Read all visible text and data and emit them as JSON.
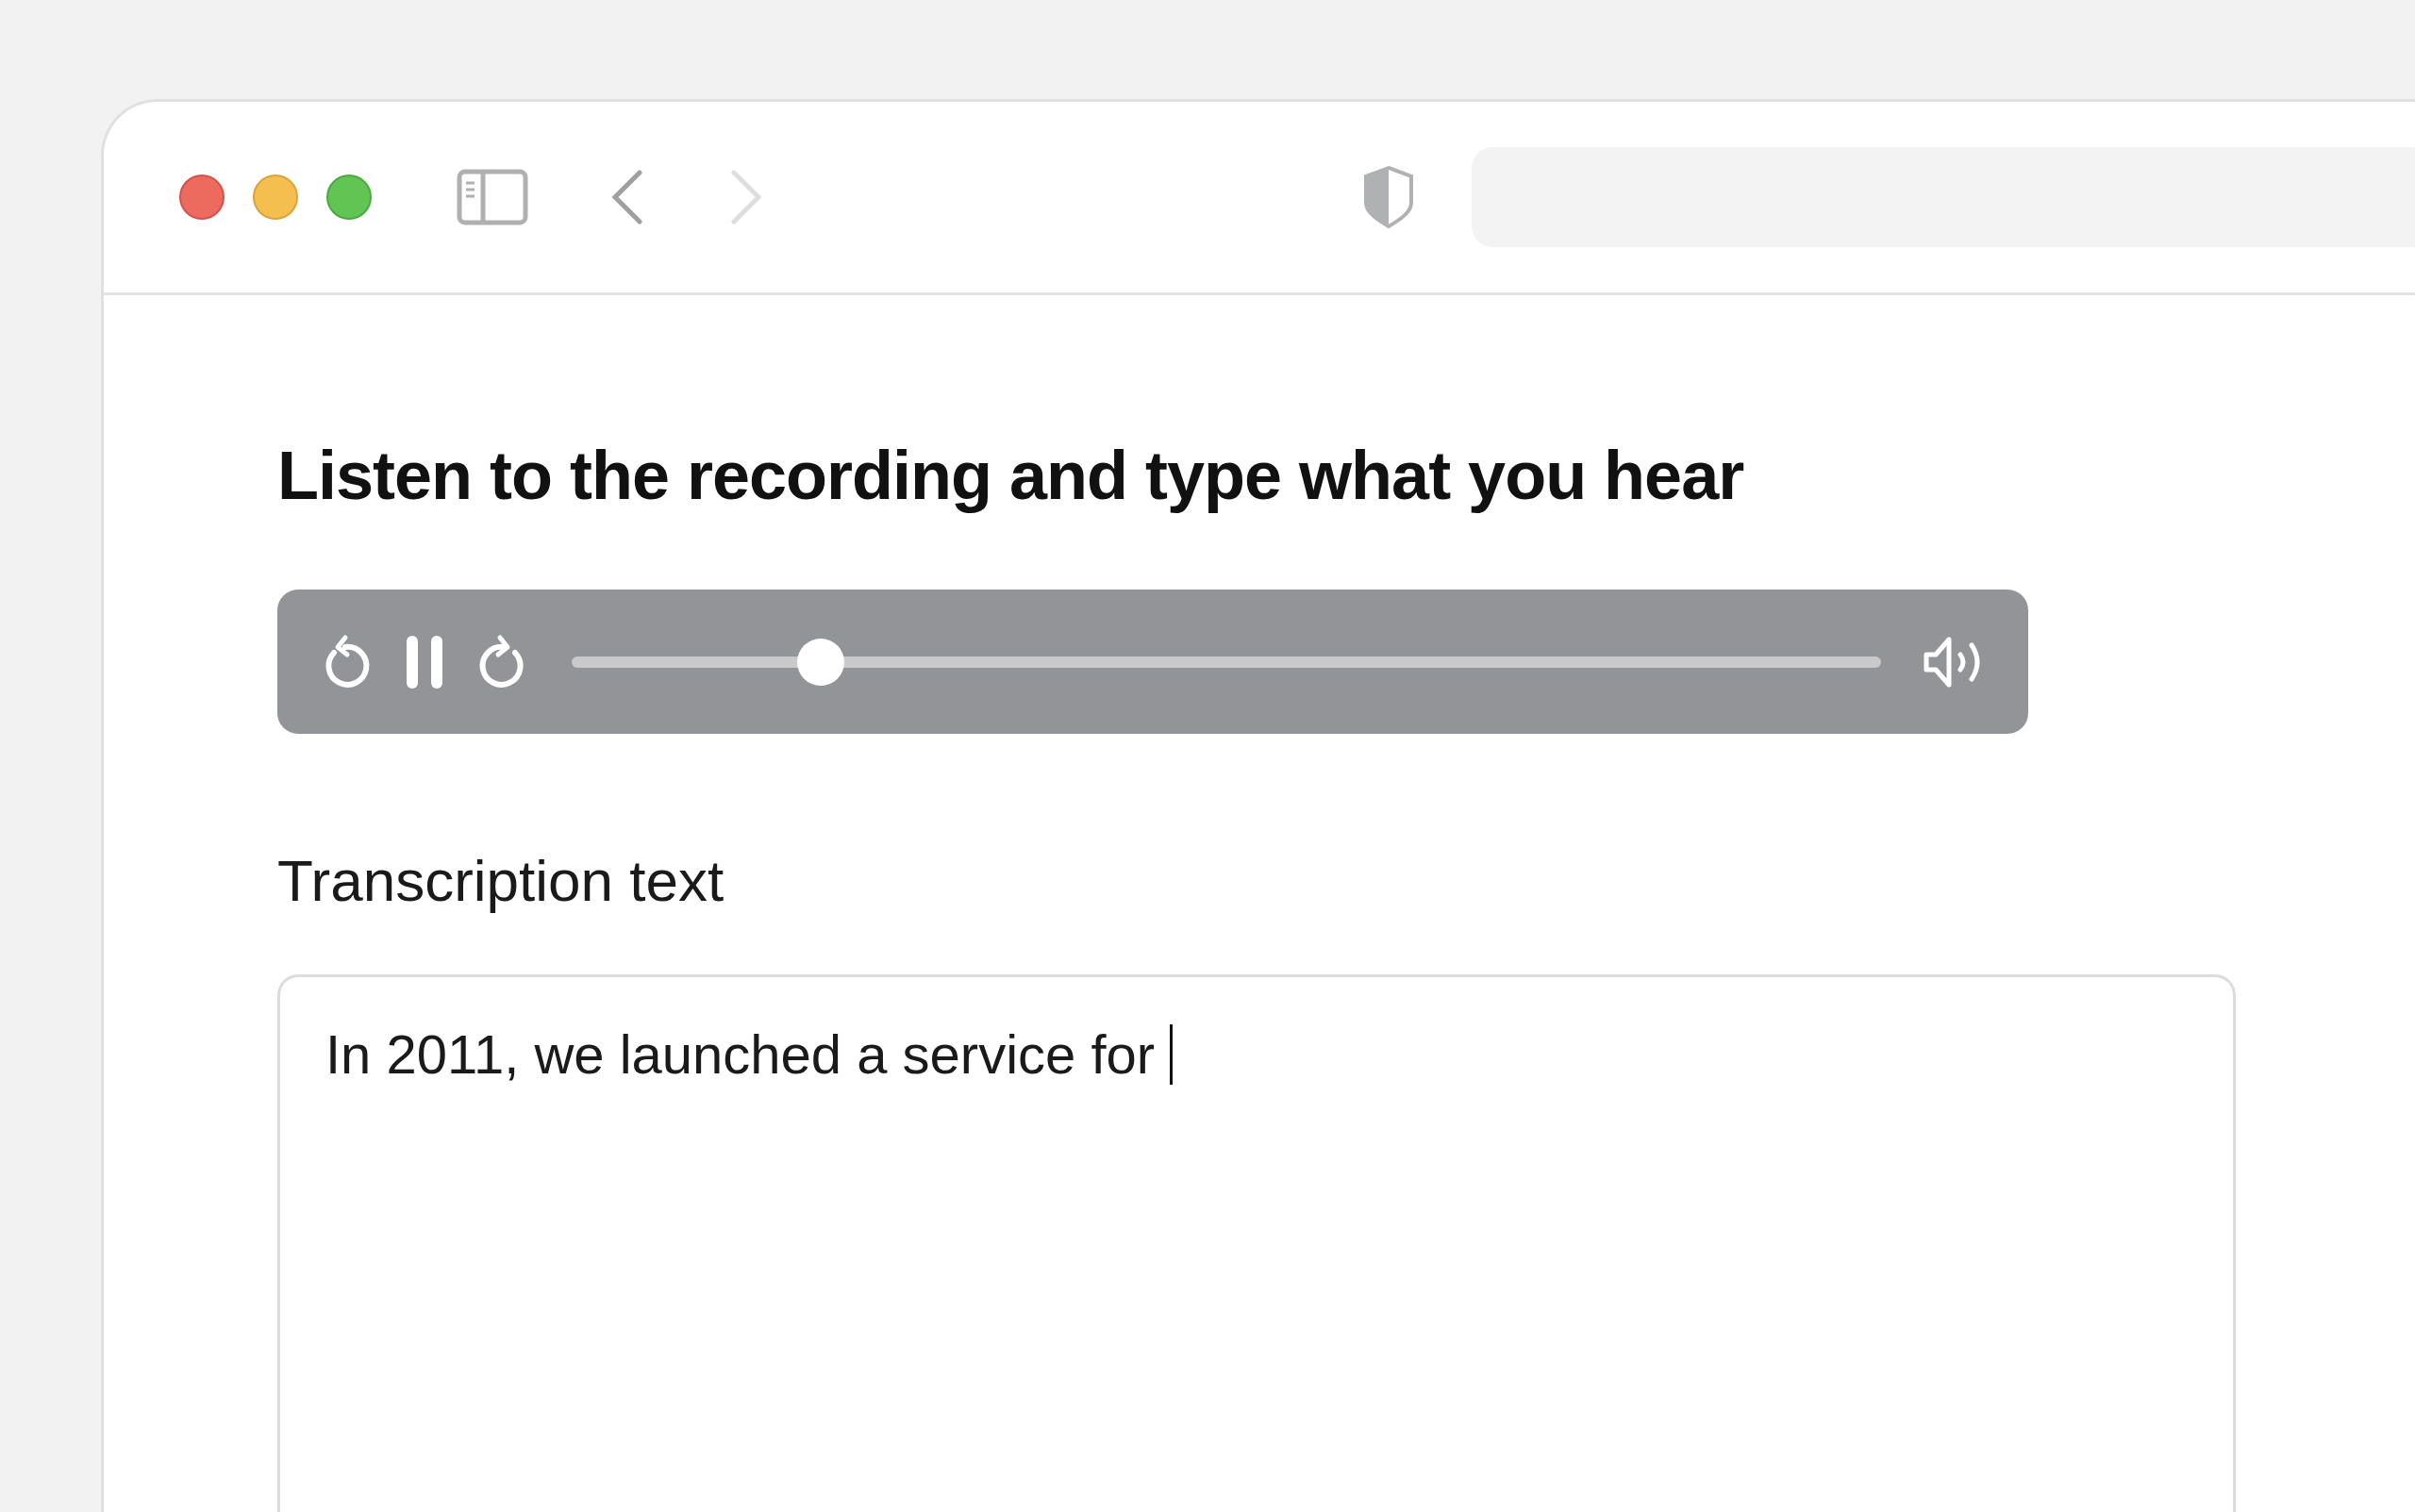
{
  "heading": "Listen to the recording and type what you hear",
  "player": {
    "playing": true,
    "level": 0.19
  },
  "field": {
    "label": "Transcription text",
    "value": "In 2011, we launched a service for "
  }
}
